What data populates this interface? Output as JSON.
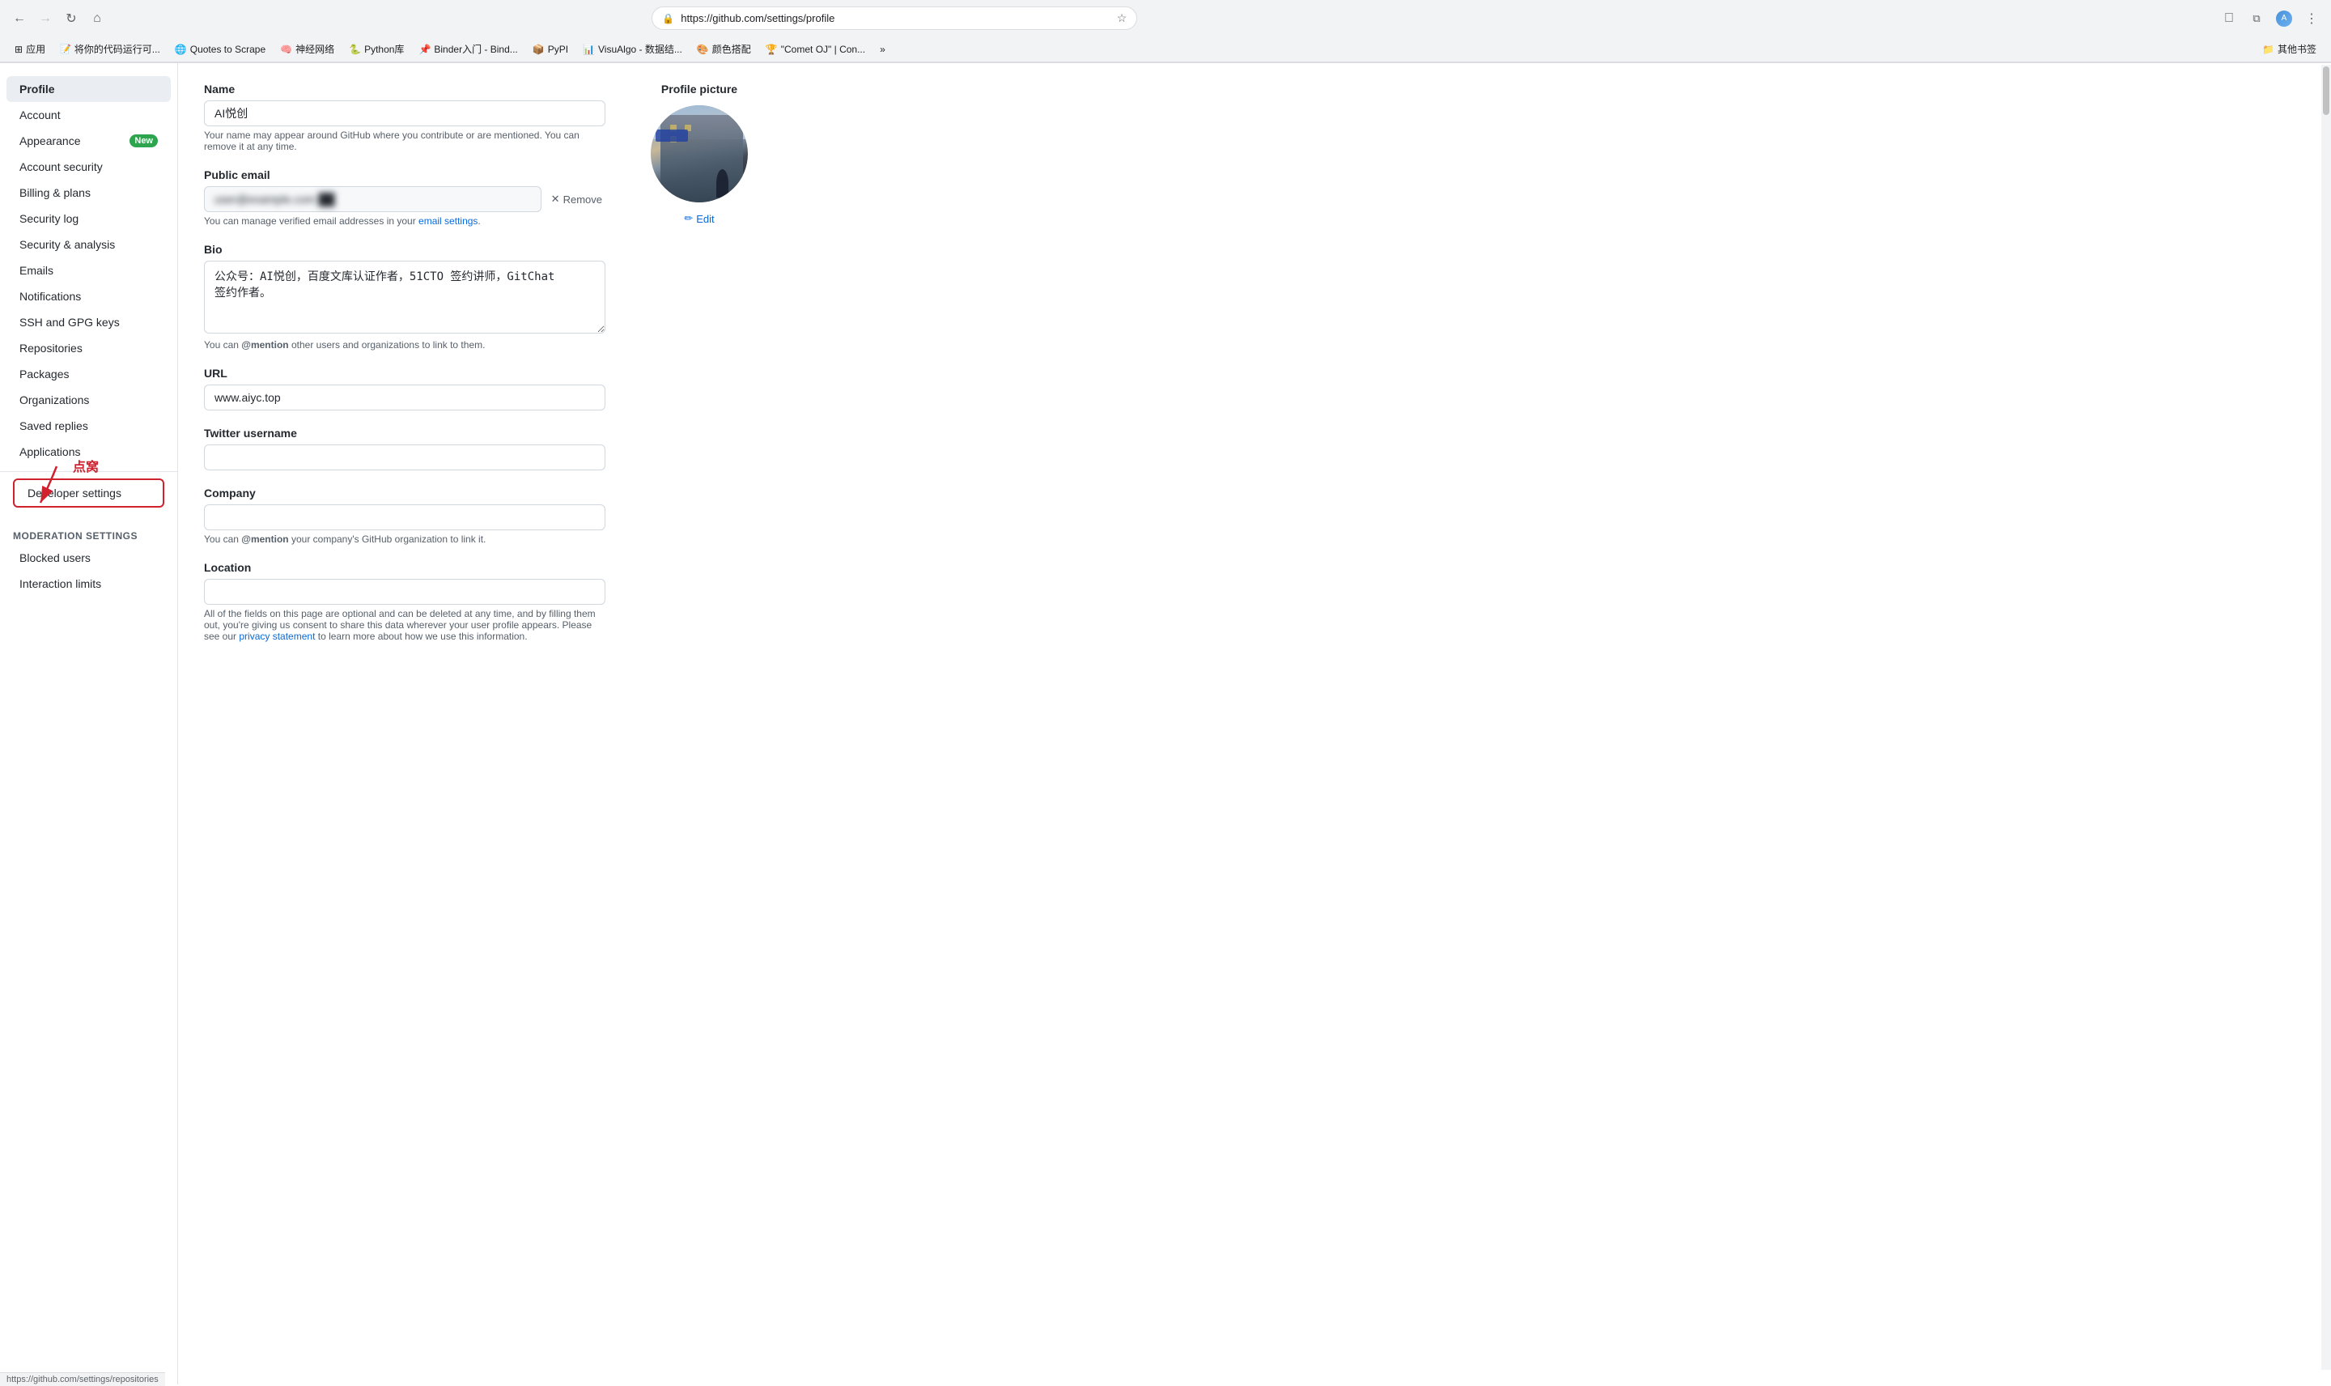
{
  "browser": {
    "url": "https://github.com/settings/profile",
    "back_disabled": false,
    "forward_disabled": false,
    "status_url": "https://github.com/settings/repositories"
  },
  "bookmarks": [
    {
      "id": "apps",
      "icon": "⊞",
      "label": "应用"
    },
    {
      "id": "code",
      "icon": "📝",
      "label": "将你的代码运行可..."
    },
    {
      "id": "quotes",
      "icon": "🌐",
      "label": "Quotes to Scrape"
    },
    {
      "id": "neural",
      "icon": "🧠",
      "label": "神经网络"
    },
    {
      "id": "python",
      "icon": "🐍",
      "label": "Python库"
    },
    {
      "id": "binder",
      "icon": "📌",
      "label": "Binder入门 - Bind..."
    },
    {
      "id": "pypi",
      "icon": "📦",
      "label": "PyPI"
    },
    {
      "id": "visalgo",
      "icon": "📊",
      "label": "VisuAlgo - 数据结..."
    },
    {
      "id": "colors",
      "icon": "🎨",
      "label": "颜色搭配"
    },
    {
      "id": "comet",
      "icon": "🏆",
      "label": "\"Comet OJ\" | Con..."
    },
    {
      "id": "more",
      "icon": "»",
      "label": ""
    },
    {
      "id": "folder",
      "icon": "📁",
      "label": "其他书签"
    }
  ],
  "sidebar": {
    "items": [
      {
        "id": "profile",
        "label": "Profile",
        "active": true,
        "badge": null
      },
      {
        "id": "account",
        "label": "Account",
        "active": false,
        "badge": null
      },
      {
        "id": "appearance",
        "label": "Appearance",
        "active": false,
        "badge": "New"
      },
      {
        "id": "account-security",
        "label": "Account security",
        "active": false,
        "badge": null
      },
      {
        "id": "billing",
        "label": "Billing & plans",
        "active": false,
        "badge": null
      },
      {
        "id": "security-log",
        "label": "Security log",
        "active": false,
        "badge": null
      },
      {
        "id": "security-analysis",
        "label": "Security & analysis",
        "active": false,
        "badge": null
      },
      {
        "id": "emails",
        "label": "Emails",
        "active": false,
        "badge": null
      },
      {
        "id": "notifications",
        "label": "Notifications",
        "active": false,
        "badge": null
      },
      {
        "id": "ssh-keys",
        "label": "SSH and GPG keys",
        "active": false,
        "badge": null
      },
      {
        "id": "repositories",
        "label": "Repositories",
        "active": false,
        "badge": null
      },
      {
        "id": "packages",
        "label": "Packages",
        "active": false,
        "badge": null
      },
      {
        "id": "organizations",
        "label": "Organizations",
        "active": false,
        "badge": null
      },
      {
        "id": "saved-replies",
        "label": "Saved replies",
        "active": false,
        "badge": null
      },
      {
        "id": "applications",
        "label": "Applications",
        "active": false,
        "badge": null
      }
    ],
    "developer_settings": {
      "label": "Developer settings"
    },
    "moderation": {
      "section_label": "Moderation settings",
      "items": [
        {
          "id": "blocked-users",
          "label": "Blocked users"
        },
        {
          "id": "interaction-limits",
          "label": "Interaction limits"
        }
      ]
    }
  },
  "profile": {
    "picture_title": "Profile picture",
    "edit_label": "Edit",
    "name_label": "Name",
    "name_value": "AI悦创",
    "name_hint": "Your name may appear around GitHub where you contribute or are mentioned. You can remove it at any time.",
    "email_label": "Public email",
    "email_blurred": "██████████████████████ ██",
    "remove_label": "Remove",
    "email_hint_prefix": "You can manage verified email addresses in your ",
    "email_hint_link": "email settings",
    "email_hint_suffix": ".",
    "bio_label": "Bio",
    "bio_value": "公众号：AI悦创，百度文库认证作者，51CTO 签约讲师，GitChat\n签约作者。",
    "bio_hint_prefix": "You can ",
    "bio_hint_mention": "@mention",
    "bio_hint_suffix": " other users and organizations to link to them.",
    "url_label": "URL",
    "url_value": "www.aiyc.top",
    "twitter_label": "Twitter username",
    "twitter_value": "",
    "company_label": "Company",
    "company_value": "",
    "company_hint_prefix": "You can ",
    "company_hint_mention": "@mention",
    "company_hint_suffix": " your company's GitHub organization to link it.",
    "location_label": "Location",
    "location_value": "",
    "location_hint": "All of the fields on this page are optional and can be deleted at any time, and by filling them out, you're giving us consent to share this data wherever your user profile appears. Please see our ",
    "privacy_link": "privacy statement",
    "location_hint_suffix": " to learn more about how we use this information."
  },
  "annotation": {
    "red_text": "点窝",
    "arrow_hint": "Developer settings highlighted with red border"
  },
  "status_bar": {
    "url": "https://github.com/settings/repositories"
  }
}
